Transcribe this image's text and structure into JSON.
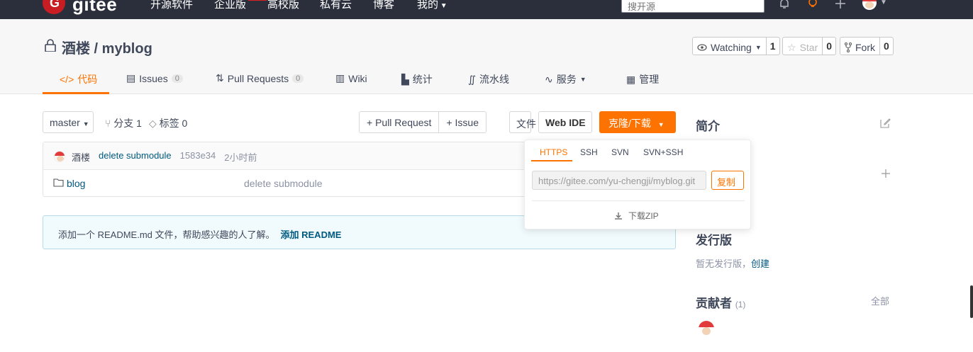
{
  "topnav": {
    "logo_letter": "G",
    "logo_text": "gitee",
    "items": [
      "开源软件",
      "企业版",
      "高校版",
      "私有云",
      "博客",
      "我的"
    ],
    "search_placeholder": "搜开源"
  },
  "project": {
    "owner": "酒楼",
    "separator": " / ",
    "name": "myblog",
    "watch_label": "Watching",
    "watch_count": "1",
    "star_label": "Star",
    "star_count": "0",
    "fork_label": "Fork",
    "fork_count": "0"
  },
  "tabs": [
    {
      "label": "代码",
      "icon": "code-icon"
    },
    {
      "label": "Issues",
      "badge": "0",
      "icon": "issues-icon"
    },
    {
      "label": "Pull Requests",
      "badge": "0",
      "icon": "pull-request-icon"
    },
    {
      "label": "Wiki",
      "icon": "wiki-icon"
    },
    {
      "label": "统计",
      "icon": "stats-icon"
    },
    {
      "label": "流水线",
      "icon": "pipeline-icon"
    },
    {
      "label": "服务",
      "icon": "service-icon"
    },
    {
      "label": "管理",
      "icon": "manage-icon"
    }
  ],
  "toolbar": {
    "branch": "master",
    "branch_count": "分支 1",
    "tag_count": "标签 0",
    "pull_request": "+ Pull Request",
    "issue": "+ Issue",
    "file": "文件",
    "web_ide": "Web IDE",
    "clone": "克隆/下载"
  },
  "commit": {
    "author": "酒楼",
    "message": "delete submodule",
    "hash": "1583e34",
    "time": "2小时前"
  },
  "files": [
    {
      "name": "blog",
      "message": "delete submodule"
    }
  ],
  "readme": {
    "text": "添加一个 README.md 文件，帮助感兴趣的人了解。",
    "link": "添加 README"
  },
  "clone_dropdown": {
    "tabs": [
      "HTTPS",
      "SSH",
      "SVN",
      "SVN+SSH"
    ],
    "active_tab": "HTTPS",
    "url": "https://gitee.com/yu-chengji/myblog.git",
    "copy": "复制",
    "download_zip": "下载ZIP"
  },
  "sidebar": {
    "intro_title": "简介",
    "release_title": "发行版",
    "release_text": "暂无发行版，",
    "release_link": "创建",
    "contributors_title": "贡献者",
    "contributors_count": "(1)",
    "contributors_all": "全部"
  },
  "colors": {
    "accent": "#fe7300",
    "nav_bg": "#2b2f3c",
    "link": "#005980"
  }
}
